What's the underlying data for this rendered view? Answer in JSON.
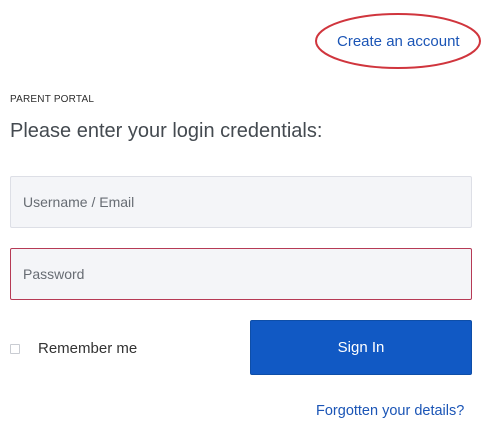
{
  "header": {
    "create_account_label": "Create an account"
  },
  "login": {
    "portal_label": "PARENT PORTAL",
    "title": "Please enter your login credentials:",
    "username_placeholder": "Username / Email",
    "password_placeholder": "Password",
    "remember_label": "Remember me",
    "sign_in_label": "Sign In",
    "forgot_label": "Forgotten your details?"
  },
  "colors": {
    "link": "#1b55b6",
    "primary_button": "#1159c4",
    "annotation_circle": "#d0353d",
    "password_border": "#b63a55"
  }
}
